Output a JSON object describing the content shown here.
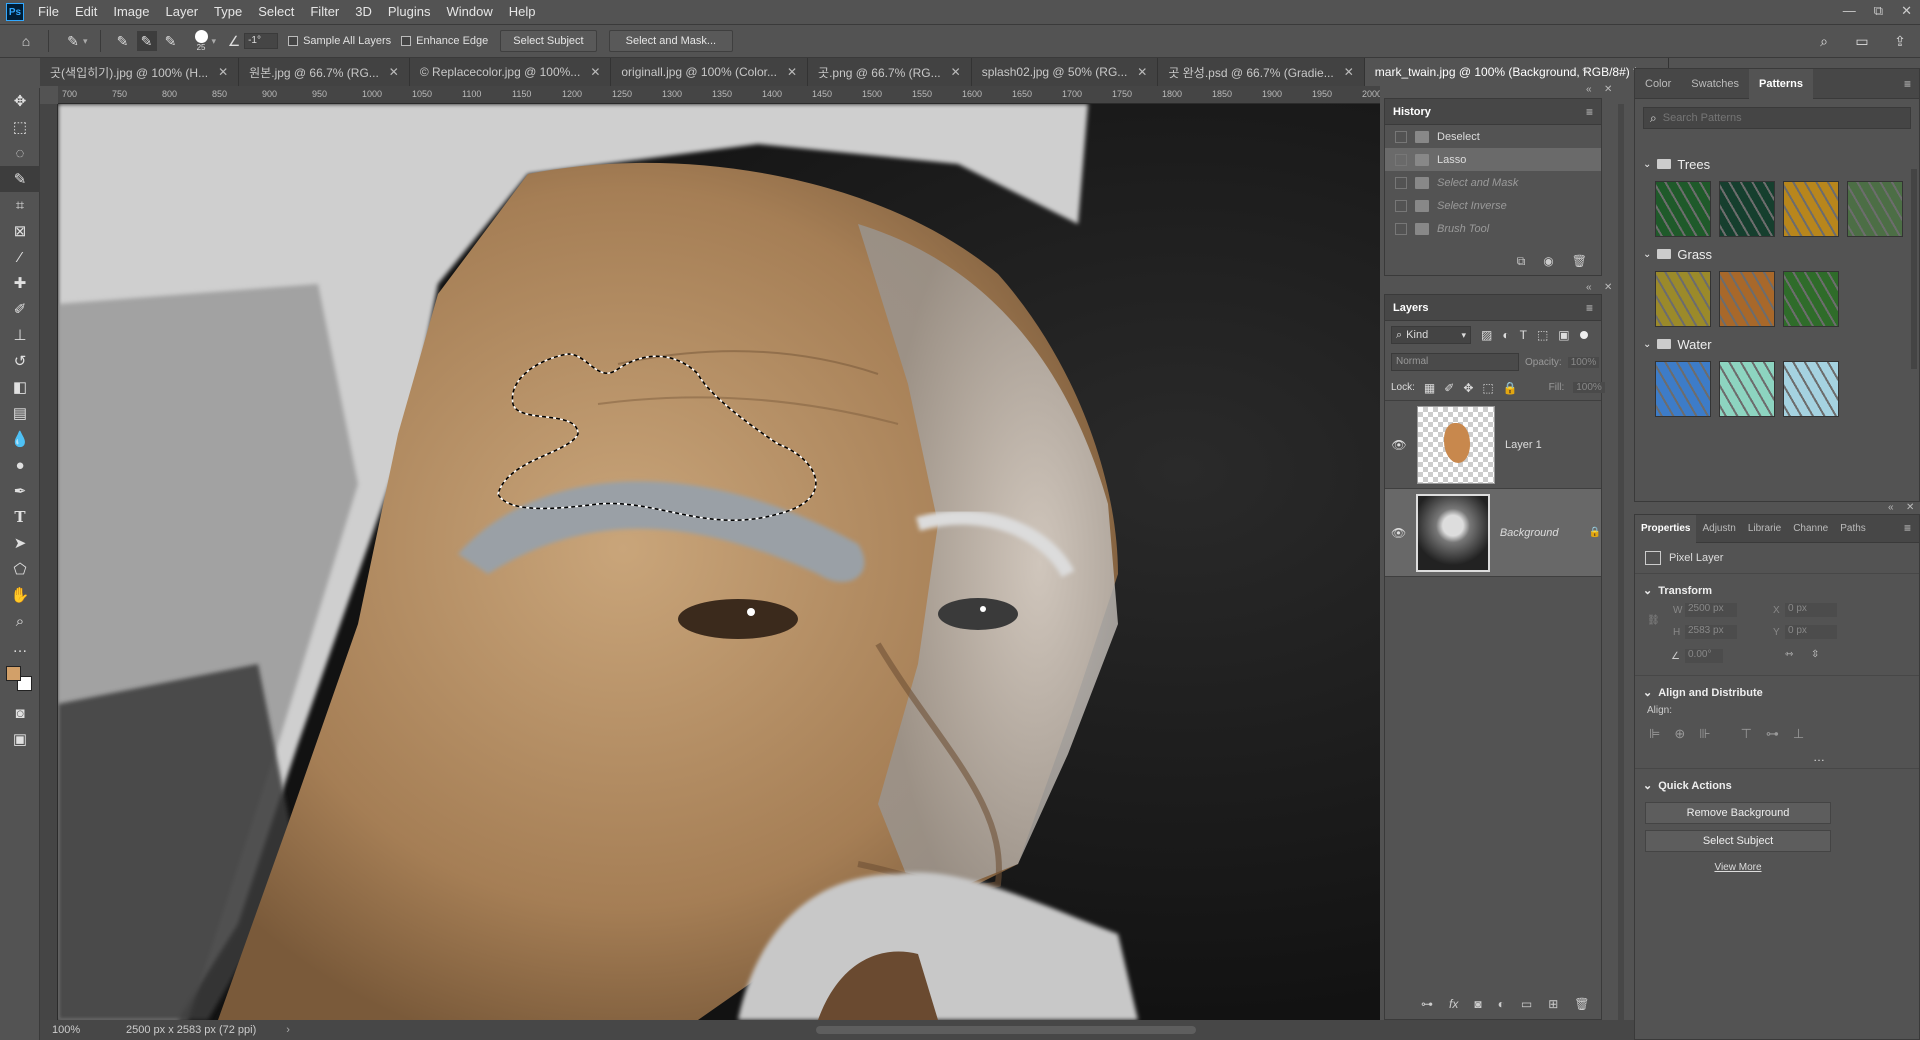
{
  "app": {
    "logo": "Ps"
  },
  "menu": [
    "File",
    "Edit",
    "Image",
    "Layer",
    "Type",
    "Select",
    "Filter",
    "3D",
    "Plugins",
    "Window",
    "Help"
  ],
  "window_controls": {
    "minimize": "—",
    "restore": "⧉",
    "close": "✕"
  },
  "options": {
    "brush_size": "25",
    "angle_value": "-1°",
    "sample_all_layers": "Sample All Layers",
    "enhance_edge": "Enhance Edge",
    "select_subject": "Select Subject",
    "select_and_mask": "Select and Mask..."
  },
  "tabs": [
    {
      "label": "곳(색입히기).jpg @ 100% (H...",
      "active": false
    },
    {
      "label": "원본.jpg @ 66.7% (RG...",
      "active": false
    },
    {
      "label": "© Replacecolor.jpg @ 100%...",
      "active": false
    },
    {
      "label": "originall.jpg @ 100% (Color...",
      "active": false
    },
    {
      "label": "곳.png @ 66.7% (RG...",
      "active": false
    },
    {
      "label": "splash02.jpg @ 50% (RG...",
      "active": false
    },
    {
      "label": "곳 완성.psd @ 66.7% (Gradie...",
      "active": false
    },
    {
      "label": "mark_twain.jpg @ 100% (Background, RGB/8#) *",
      "active": true
    }
  ],
  "ruler_ticks": [
    "700",
    "750",
    "800",
    "850",
    "900",
    "950",
    "1000",
    "1050",
    "1100",
    "1150",
    "1200",
    "1250",
    "1300",
    "1350",
    "1400",
    "1450",
    "1500",
    "1550",
    "1600",
    "1650",
    "1700",
    "1750",
    "1800",
    "1850",
    "1900",
    "1950",
    "2000"
  ],
  "status": {
    "zoom": "100%",
    "doc_size": "2500 px x 2583 px (72 ppi)"
  },
  "history": {
    "title": "History",
    "items": [
      {
        "label": "Deselect",
        "state": "normal"
      },
      {
        "label": "Lasso",
        "state": "selected"
      },
      {
        "label": "Select and Mask",
        "state": "dim"
      },
      {
        "label": "Select Inverse",
        "state": "dim"
      },
      {
        "label": "Brush Tool",
        "state": "dim"
      }
    ]
  },
  "layers": {
    "title": "Layers",
    "filter_kind": "Kind",
    "blend_mode": "Normal",
    "opacity_label": "Opacity:",
    "opacity_value": "100%",
    "lock_label": "Lock:",
    "fill_label": "Fill:",
    "fill_value": "100%",
    "items": [
      {
        "name": "Layer 1",
        "selected": false
      },
      {
        "name": "Background",
        "selected": true
      }
    ]
  },
  "patterns": {
    "tabs": [
      "Color",
      "Swatches",
      "Patterns"
    ],
    "search_placeholder": "Search Patterns",
    "groups": [
      {
        "name": "Trees",
        "colors": [
          "#1f5a2a",
          "#163f2e",
          "#b8861c",
          "#4c6e45"
        ]
      },
      {
        "name": "Grass",
        "colors": [
          "#9b8a2a",
          "#a8682a",
          "#2f6c2a"
        ]
      },
      {
        "name": "Water",
        "colors": [
          "#3d7cc8",
          "#8dd4c0",
          "#a5d2e0"
        ]
      }
    ]
  },
  "properties": {
    "tabs": [
      "Properties",
      "Adjustn",
      "Librarie",
      "Channe",
      "Paths"
    ],
    "layer_type": "Pixel Layer",
    "transform_title": "Transform",
    "w_label": "W",
    "w_value": "2500 px",
    "h_label": "H",
    "h_value": "2583 px",
    "x_label": "X",
    "x_value": "0 px",
    "y_label": "Y",
    "y_value": "0 px",
    "angle_value": "0.00°",
    "align_title": "Align and Distribute",
    "align_label": "Align:",
    "quick_actions_title": "Quick Actions",
    "remove_background": "Remove Background",
    "select_subject": "Select Subject",
    "view_more": "View More"
  },
  "colors": {
    "foreground": "#d2a069",
    "background": "#ffffff",
    "accent": "#31a8ff"
  }
}
